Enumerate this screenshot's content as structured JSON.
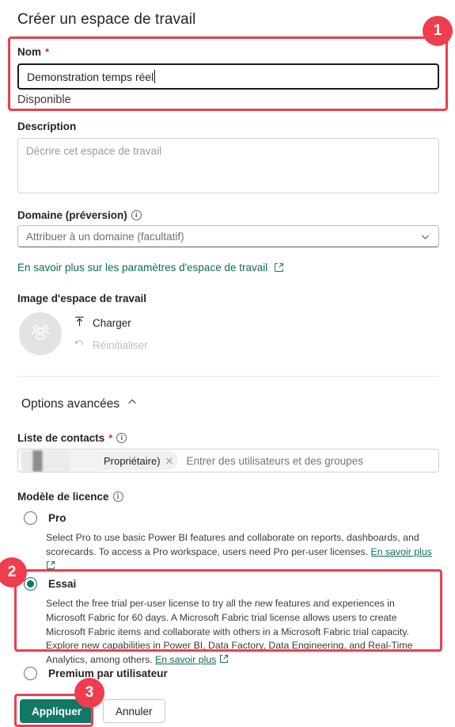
{
  "dialog": {
    "title": "Créer un espace de travail"
  },
  "name_field": {
    "label": "Nom",
    "required_marker": "*",
    "value": "Demonstration temps réel",
    "availability": "Disponible"
  },
  "description_field": {
    "label": "Description",
    "placeholder": "Décrire cet espace de travail"
  },
  "domain_field": {
    "label": "Domaine (préversion)",
    "info_icon": "info-icon",
    "selected": "Attribuer à un domaine (facultatif)",
    "chevron_icon": "chevron-down-icon"
  },
  "learn_more_link": {
    "text": "En savoir plus sur les paramètres d'espace de travail",
    "icon": "external-link-icon",
    "color": "#0f6b57"
  },
  "workspace_image": {
    "label": "Image d'espace de travail",
    "avatar_icon": "people-group-icon",
    "upload_label": "Charger",
    "upload_icon": "upload-arrow-icon",
    "reset_label": "Réinitialiser",
    "reset_icon": "undo-arrow-icon"
  },
  "advanced": {
    "header": "Options avancées",
    "chevron_icon": "chevron-up-icon"
  },
  "contact_list": {
    "label": "Liste de contacts",
    "required_marker": "*",
    "info_icon": "info-icon",
    "pill_text": "Propriétaire)",
    "pill_remove_icon": "close-icon",
    "placeholder": "Entrer des utilisateurs et des groupes"
  },
  "license": {
    "label": "Modèle de licence",
    "info_icon": "info-icon",
    "options": [
      {
        "id": "pro",
        "label": "Pro",
        "selected": false,
        "description": "Select Pro to use basic Power BI features and collaborate on reports, dashboards, and scorecards. To access a Pro workspace, users need Pro per-user licenses.",
        "link_text": "En savoir plus",
        "link_icon": "external-link-icon"
      },
      {
        "id": "essai",
        "label": "Essai",
        "selected": true,
        "description": "Select the free trial per-user license to try all the new features and experiences in Microsoft Fabric for 60 days. A Microsoft Fabric trial license allows users to create Microsoft Fabric items and collaborate with others in a Microsoft Fabric trial capacity. Explore new capabilities in Power BI, Data Factory, Data Engineering, and Real-Time Analytics, among others.",
        "link_text": "En savoir plus",
        "link_icon": "external-link-icon"
      },
      {
        "id": "premium-par-utilisateur",
        "label": "Premium par utilisateur",
        "selected": false,
        "description": "",
        "link_text": "",
        "link_icon": ""
      }
    ]
  },
  "footer": {
    "apply_label": "Appliquer",
    "cancel_label": "Annuler"
  },
  "annotations": {
    "color": "#ee3e4e",
    "badges": [
      {
        "number": "1",
        "targets": "name-field"
      },
      {
        "number": "2",
        "targets": "essai-license-option"
      },
      {
        "number": "3",
        "targets": "apply-button"
      }
    ]
  },
  "theme": {
    "accent": "#117865",
    "link": "#0f6b57",
    "annotation": "#ee3e4e",
    "required": "#d13438"
  }
}
